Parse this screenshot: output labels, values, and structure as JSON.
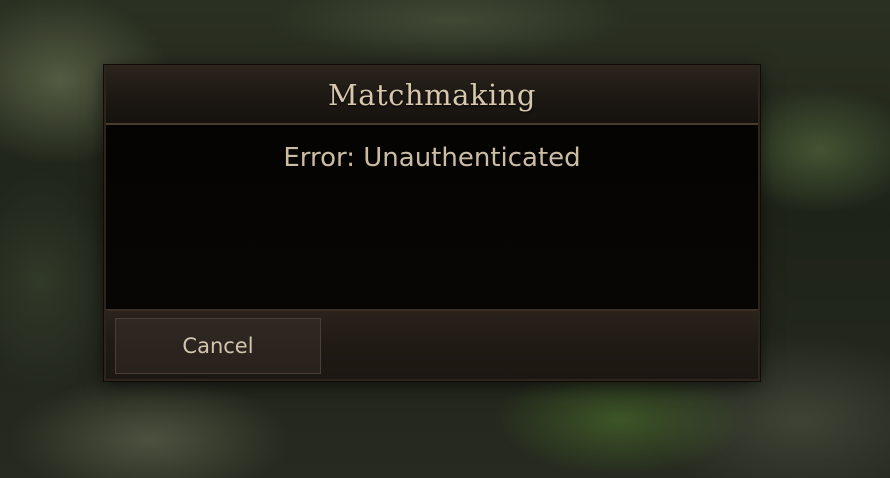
{
  "dialog": {
    "title": "Matchmaking",
    "message": "Error: Unauthenticated",
    "cancel_label": "Cancel"
  },
  "colors": {
    "dialog_background": "#060504",
    "header_background": "#1d1813",
    "footer_background": "#201a15",
    "text": "#cbbda4",
    "button_background": "#2c241e",
    "button_border": "#4a3f35"
  }
}
